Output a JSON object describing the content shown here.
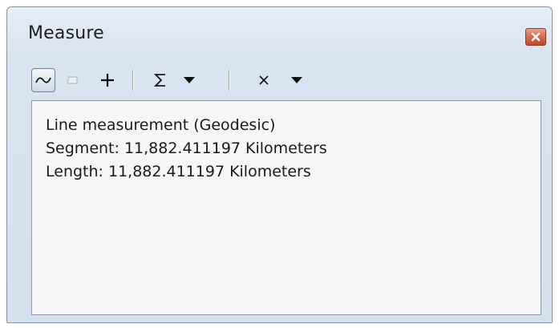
{
  "window": {
    "title": "Measure"
  },
  "toolbar": {
    "tools": [
      {
        "name": "measure-line-tool",
        "icon": "line-wave-icon",
        "active": true
      },
      {
        "name": "measure-area-tool",
        "icon": "polygon-icon",
        "enabled": false
      },
      {
        "name": "measure-feature-tool",
        "icon": "plus-icon"
      },
      {
        "name": "show-total-tool",
        "icon": "sigma-icon"
      },
      {
        "name": "clear-results-tool",
        "icon": "x-icon"
      }
    ]
  },
  "results": {
    "lines": [
      "Line measurement (Geodesic)",
      "Segment: 11,882.411197 Kilometers",
      "Length: 11,882.411197 Kilometers"
    ]
  },
  "colors": {
    "window_bg": "#d9e4f1",
    "close_button": "#d66a4f",
    "content_bg": "#f7f7f7"
  }
}
